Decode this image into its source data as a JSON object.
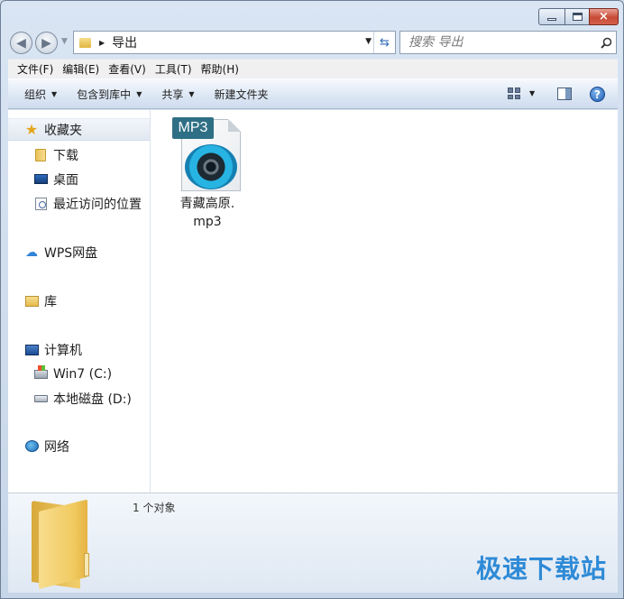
{
  "window": {
    "caption": {
      "minimize": "minimize",
      "maximize": "maximize",
      "close": "×"
    }
  },
  "nav": {
    "address_path": "导出",
    "search_placeholder": "搜索 导出"
  },
  "menubar": [
    "文件(F)",
    "编辑(E)",
    "查看(V)",
    "工具(T)",
    "帮助(H)"
  ],
  "commandbar": {
    "organize": "组织",
    "include_library": "包含到库中",
    "share": "共享",
    "new_folder": "新建文件夹"
  },
  "sidebar": {
    "favorites": "收藏夹",
    "downloads": "下载",
    "desktop": "桌面",
    "recent": "最近访问的位置",
    "wps": "WPS网盘",
    "libraries": "库",
    "computer": "计算机",
    "drive_c": "Win7 (C:)",
    "drive_d": "本地磁盘 (D:)",
    "network": "网络"
  },
  "content": {
    "file": {
      "tag": "MP3",
      "name_line1": "青藏高原.",
      "name_line2": "mp3"
    }
  },
  "details": {
    "count": "1 个对象",
    "watermark": "极速下载站"
  },
  "icons": {
    "back": "arrow-left-icon",
    "forward": "arrow-right-icon",
    "refresh": "refresh-icon",
    "search": "search-icon",
    "help": "help-icon"
  }
}
